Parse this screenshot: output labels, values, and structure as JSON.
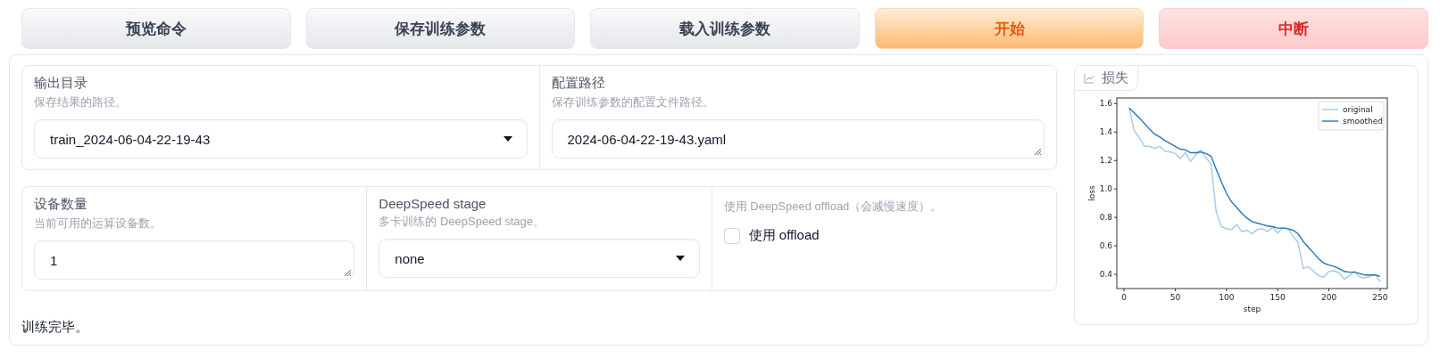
{
  "buttons": [
    {
      "label": "预览命令",
      "kind": "default"
    },
    {
      "label": "保存训练参数",
      "kind": "default"
    },
    {
      "label": "载入训练参数",
      "kind": "default"
    },
    {
      "label": "开始",
      "kind": "primary"
    },
    {
      "label": "中断",
      "kind": "stop"
    }
  ],
  "form_rows": [
    {
      "fields": [
        {
          "kind": "dropdown",
          "label": "输出目录",
          "info": "保存结果的路径。",
          "value": "train_2024-06-04-22-19-43"
        },
        {
          "kind": "textbox",
          "label": "配置路径",
          "info": "保存训练参数的配置文件路径。",
          "value": "2024-06-04-22-19-43.yaml"
        }
      ]
    },
    {
      "fields": [
        {
          "kind": "textbox",
          "label": "设备数量",
          "info": "当前可用的运算设备数。",
          "value": "1"
        },
        {
          "kind": "dropdown",
          "label": "DeepSpeed stage",
          "info": "多卡训练的 DeepSpeed stage。",
          "value": "none"
        },
        {
          "kind": "checkbox",
          "info": "使用 DeepSpeed offload（会减慢速度）。",
          "option": "使用 offload",
          "checked": false
        }
      ]
    }
  ],
  "status": "训练完毕。",
  "plot": {
    "tab": "损失",
    "chart_data": {
      "type": "line",
      "xlabel": "step",
      "ylabel": "loss",
      "x": [
        5,
        10,
        15,
        20,
        25,
        30,
        35,
        40,
        45,
        50,
        55,
        60,
        65,
        70,
        75,
        80,
        85,
        90,
        95,
        100,
        105,
        110,
        115,
        120,
        125,
        130,
        135,
        140,
        145,
        150,
        155,
        160,
        165,
        170,
        175,
        180,
        185,
        190,
        195,
        200,
        205,
        210,
        215,
        220,
        225,
        230,
        235,
        240,
        245,
        250
      ],
      "series": [
        {
          "name": "original",
          "color": "#a6c8e0",
          "values": [
            1.57,
            1.41,
            1.36,
            1.3,
            1.3,
            1.285,
            1.3,
            1.265,
            1.26,
            1.25,
            1.215,
            1.255,
            1.195,
            1.24,
            1.275,
            1.22,
            1.175,
            0.84,
            0.735,
            0.72,
            0.715,
            0.75,
            0.7,
            0.71,
            0.685,
            0.715,
            0.72,
            0.7,
            0.73,
            0.69,
            0.73,
            0.72,
            0.67,
            0.62,
            0.44,
            0.455,
            0.42,
            0.39,
            0.38,
            0.42,
            0.425,
            0.41,
            0.365,
            0.39,
            0.42,
            0.38,
            0.375,
            0.385,
            0.4,
            0.35
          ]
        },
        {
          "name": "smoothed",
          "color": "#1f77b4",
          "values": [
            1.57,
            1.535,
            1.5,
            1.46,
            1.42,
            1.385,
            1.365,
            1.34,
            1.32,
            1.3,
            1.28,
            1.275,
            1.255,
            1.255,
            1.26,
            1.25,
            1.23,
            1.14,
            1.05,
            0.97,
            0.91,
            0.87,
            0.83,
            0.795,
            0.77,
            0.76,
            0.75,
            0.74,
            0.735,
            0.725,
            0.725,
            0.72,
            0.71,
            0.685,
            0.63,
            0.59,
            0.55,
            0.51,
            0.48,
            0.465,
            0.455,
            0.44,
            0.42,
            0.415,
            0.415,
            0.405,
            0.395,
            0.395,
            0.395,
            0.385
          ]
        }
      ],
      "legend": "upper right",
      "xlim": [
        -7,
        257
      ],
      "ylim": [
        0.3,
        1.64
      ],
      "xticks": [
        0,
        50,
        100,
        150,
        200,
        250
      ],
      "yticks": [
        {
          "value": 0.4,
          "label": "0.4"
        },
        {
          "value": 0.6,
          "label": "0.6"
        },
        {
          "value": 0.8,
          "label": "0.8"
        },
        {
          "value": 1.0,
          "label": "1.0"
        },
        {
          "value": 1.2,
          "label": "1.2"
        },
        {
          "value": 1.4,
          "label": "1.4"
        },
        {
          "value": 1.6,
          "label": "1.6"
        }
      ]
    }
  }
}
